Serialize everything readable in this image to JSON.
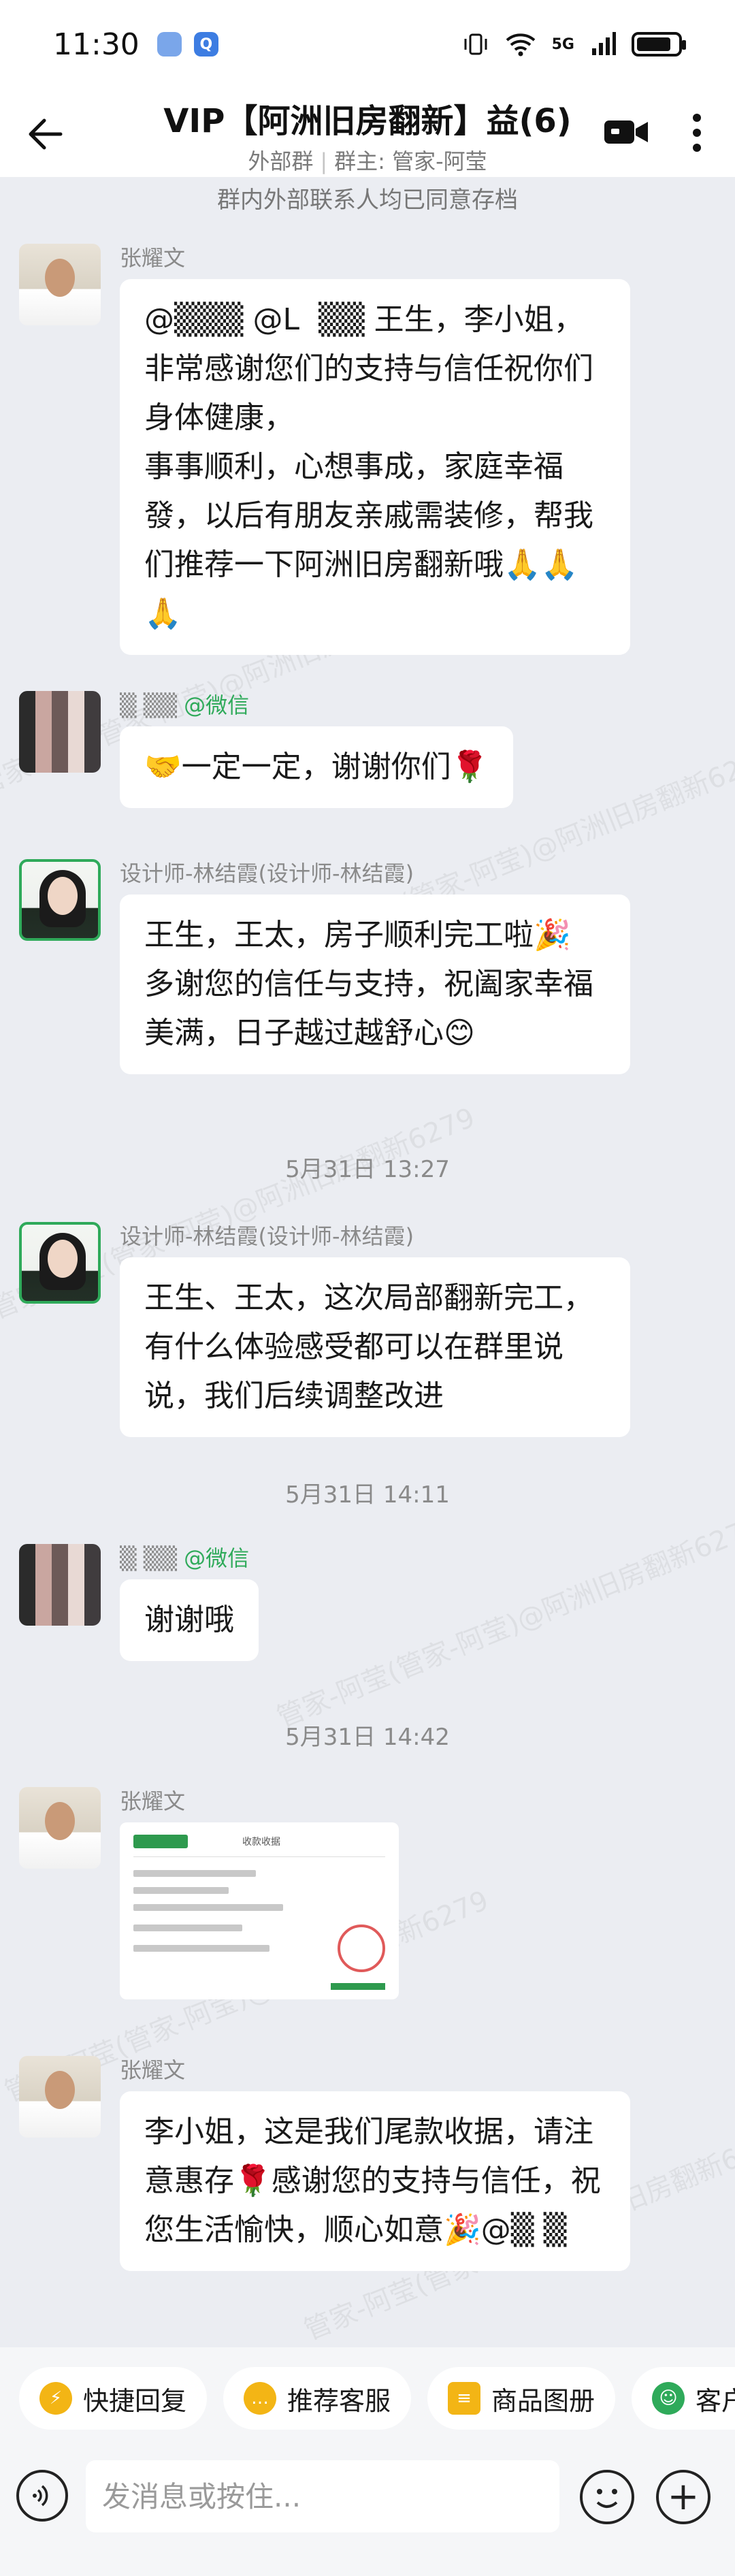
{
  "status_bar": {
    "time": "11:30",
    "network": "5G",
    "battery_level": 0.85
  },
  "header": {
    "title": "VIP【阿洲旧房翻新】益(6)",
    "group_type": "外部群",
    "group_owner": "群主: 管家-阿莹"
  },
  "notice": "群内外部联系人均已同意存档",
  "watermark": "管家-阿莹(管家-阿莹)@阿洲旧房翻新6279",
  "messages": [
    {
      "sender": "张耀文",
      "text": "@▒▒▒ @L  ▒▒ 王生，李小姐，\n非常感谢您们的支持与信任祝你们身体健康，\n事事顺利，心想事成，家庭幸福發，以后有朋友亲戚需装修，帮我们推荐一下阿洲旧房翻新哦🙏🙏🙏"
    },
    {
      "sender": "▒ ▒▒",
      "sender_tag": "@微信",
      "text": "🤝一定一定，谢谢你们🌹"
    },
    {
      "sender": "设计师-林结霞(设计师-林结霞)",
      "text": "王生，王太，房子顺利完工啦🎉\n多谢您的信任与支持，祝阖家幸福美满，日子越过越舒心😊"
    },
    {
      "time": "5月31日  13:27"
    },
    {
      "sender": "设计师-林结霞(设计师-林结霞)",
      "text": "王生、王太，这次局部翻新完工，有什么体验感受都可以在群里说说，我们后续调整改进"
    },
    {
      "time": "5月31日  14:11"
    },
    {
      "sender": "▒ ▒▒",
      "sender_tag": "@微信",
      "text": "谢谢哦"
    },
    {
      "time": "5月31日  14:42"
    },
    {
      "sender": "张耀文",
      "image": "收款收据",
      "receipt_title": "收款收据"
    },
    {
      "sender": "张耀文",
      "text": "李小姐，这是我们尾款收据，请注意惠存🌹感谢您的支持与信任，祝您生活愉快，顺心如意🎉@▒ ▒"
    }
  ],
  "quick_actions": [
    {
      "label": "快捷回复",
      "icon": "quick-reply-icon"
    },
    {
      "label": "推荐客服",
      "icon": "recommend-service-icon"
    },
    {
      "label": "商品图册",
      "icon": "product-album-icon"
    },
    {
      "label": "客户",
      "icon": "customer-icon"
    }
  ],
  "input": {
    "placeholder": "发消息或按住..."
  },
  "colors": {
    "background": "#ebedf2",
    "bubble": "#ffffff",
    "wechat_tag": "#2faa5a",
    "accent_yellow": "#f3b515"
  }
}
